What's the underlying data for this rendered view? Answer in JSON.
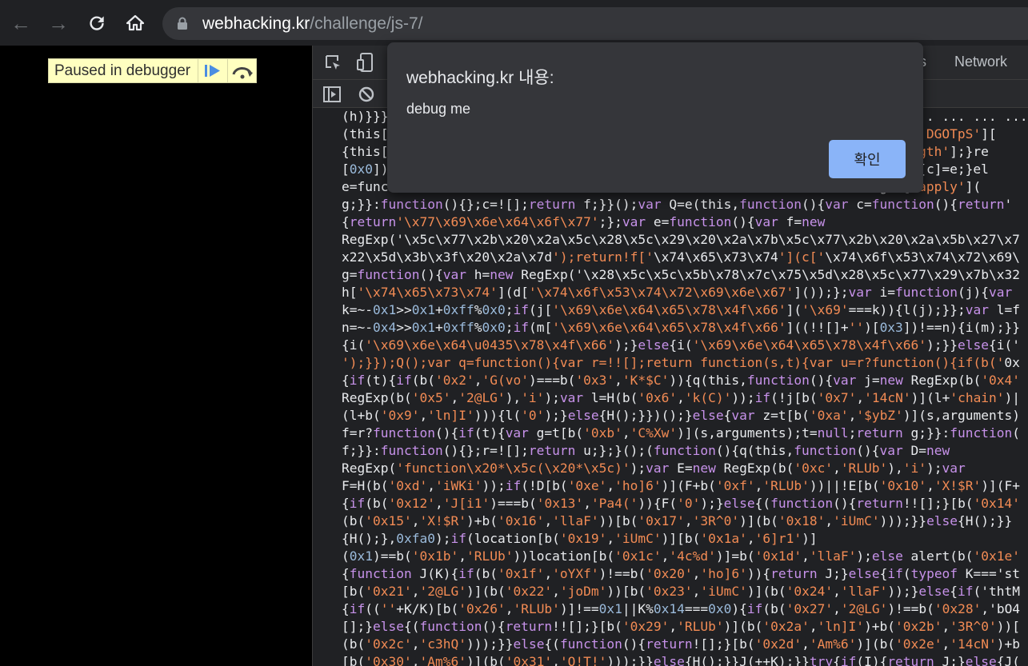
{
  "browser": {
    "url_host": "webhacking.kr",
    "url_path": "/challenge/js-7/"
  },
  "debugger_banner": {
    "label": "Paused in debugger"
  },
  "devtools": {
    "tab_partial": "s",
    "tab_network": "Network",
    "code_lines": [
      "(h)}}}); ... ... ... ... ... ... ... ... ... ... ... ... ... ... ... ... ... ... ... ... ... ...n this['Eqs",
      "(this[                                                               this['DGOTpS'][",
      "{this[                                                               ['length'];}re",
      "[0x0])                                                               ald'][c]=e;}el",
      "e=func                                                               g=e['apply'](",
      "g;}}:function(){};c=![];return f;}}();var Q=e(this,function(){var c=function(){return'",
      "{return'\\x77\\x69\\x6e\\x64\\x6f\\x77';};var e=function(){var f=new",
      "RegExp('\\x5c\\x77\\x2b\\x20\\x2a\\x5c\\x28\\x5c\\x29\\x20\\x2a\\x7b\\x5c\\x77\\x2b\\x20\\x2a\\x5b\\x27\\x7",
      "x22\\x5d\\x3b\\x3f\\x20\\x2a\\x7d');return!f['\\x74\\x65\\x73\\x74'](c['\\x74\\x6f\\x53\\x74\\x72\\x69\\",
      "g=function(){var h=new RegExp('\\x28\\x5c\\x5c\\x5b\\x78\\x7c\\x75\\x5d\\x28\\x5c\\x77\\x29\\x7b\\x32",
      "h['\\x74\\x65\\x73\\x74'](d['\\x74\\x6f\\x53\\x74\\x72\\x69\\x6e\\x67']());};var i=function(j){var",
      "k=~-0x1>>0x1+0xff%0x0;if(j['\\x69\\x6e\\x64\\x65\\x78\\x4f\\x66']('\\x69'===k)){l(j);}};var l=f",
      "n=~-0x4>>0x1+0xff%0x0;if(m['\\x69\\x6e\\x64\\x65\\x78\\x4f\\x66']((!![]+'')[0x3])!==n){i(m);}}",
      "{i('\\x69\\x6e\\x64\\u0435\\x78\\x4f\\x66');}else{i('\\x69\\x6e\\x64\\x65\\x78\\x4f\\x66');}}else{i('",
      "');}});Q();var q=function(){var r=!![];return function(s,t){var u=r?function(){if(b('0x",
      "{if(t){if(b('0x2','G(vo')===b('0x3','K*$C')){q(this,function(){var j=new RegExp(b('0x4'",
      "RegExp(b('0x5','2@LG'),'i');var l=H(b('0x6','k(C)'));if(!j[b('0x7','14cN')](l+'chain')|",
      "(l+b('0x9','ln]I'))){l('0');}else{H();}})();}else{var z=t[b('0xa','$ybZ')](s,arguments)",
      "f=r?function(){if(t){var g=t[b('0xb','C%Xw')](s,arguments);t=null;return g;}}:function(",
      "f;}}:function(){};r=![];return u;};}();(function(){q(this,function(){var D=new",
      "RegExp('function\\x20*\\x5c(\\x20*\\x5c)');var E=new RegExp(b('0xc','RLUb'),'i');var",
      "F=H(b('0xd','iWKi'));if(!D[b('0xe','ho]6')](F+b('0xf','RLUb'))||!E[b('0x10','X!$R')](F+",
      "{if(b('0x12','J[i1')===b('0x13','Pa4(')){F('0');}else{(function(){return!![];}[b('0x14'",
      "(b('0x15','X!$R')+b('0x16','llaF'))[b('0x17','3R^0')](b('0x18','iUmC')));}}else{H();}}",
      "{H();},0xfa0);if(location[b('0x19','iUmC')][b('0x1a','6]r1')]",
      "(0x1)==b('0x1b','RLUb'))location[b('0x1c','4c%d')]=b('0x1d','llaF');else alert(b('0x1e'",
      "{function J(K){if(b('0x1f','oYXf')!==b('0x20','ho]6')){return J;}else{if(typeof K==='st",
      "[b('0x21','2@LG')](b('0x22','joDm'))[b('0x23','iUmC')](b('0x24','llaF'));}else{if('thtM",
      "{if((''+K/K)[b('0x26','RLUb')]!==0x1||K%0x14===0x0){if(b('0x27','2@LG')!==b('0x28','bO4",
      "[];}else{(function(){return!![];}[b('0x29','RLUb')](b('0x2a','ln]I')+b('0x2b','3R^0'))[",
      "(b('0x2c','c3hQ')));}}else{(function(){return![];}[b('0x2d','Am%6')](b('0x2e','14cN')+b",
      "[b('0x30','Am%6')](b('0x31','O!T!')));}}else{H();}}J(++K);}}try{if(I){return J;}else{J("
    ]
  },
  "dialog": {
    "title": "webhacking.kr 내용:",
    "message": "debug me",
    "ok_label": "확인"
  },
  "colors": {
    "accent": "#8ab4f8",
    "keyword": "#c792ea",
    "string": "#f28b54",
    "number": "#9bbbdc"
  }
}
